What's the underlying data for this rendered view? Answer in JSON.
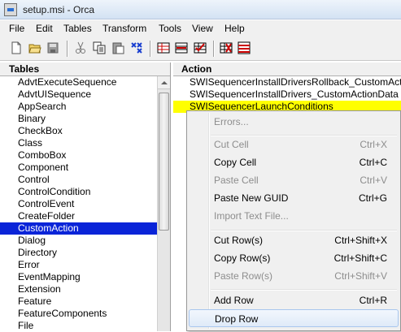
{
  "window": {
    "title": "setup.msi - Orca"
  },
  "menu": [
    "File",
    "Edit",
    "Tables",
    "Transform",
    "Tools",
    "View",
    "Help"
  ],
  "toolbar": {
    "icons": [
      "new-file-icon",
      "open-folder-icon",
      "save-icon",
      "cut-icon",
      "copy-icon",
      "paste-icon",
      "find-icon",
      "tables-icon",
      "add-row-icon",
      "validate-icon",
      "transform-icon",
      "merge-icon"
    ]
  },
  "left_pane": {
    "header": "Tables",
    "items": [
      "AdvtExecuteSequence",
      "AdvtUISequence",
      "AppSearch",
      "Binary",
      "CheckBox",
      "Class",
      "ComboBox",
      "Component",
      "Control",
      "ControlCondition",
      "ControlEvent",
      "CreateFolder",
      "CustomAction",
      "Dialog",
      "Directory",
      "Error",
      "EventMapping",
      "Extension",
      "Feature",
      "FeatureComponents",
      "File"
    ],
    "selected": "CustomAction"
  },
  "right_pane": {
    "header": "Action",
    "rows": [
      "SWISequencerInstallDriversRollback_CustomAction",
      "SWISequencerInstallDrivers_CustomActionData",
      "SWISequencerLaunchConditions"
    ],
    "highlighted_index": 2,
    "highlight_color": "#ffff00"
  },
  "context_menu": {
    "groups": [
      [
        {
          "label": "Errors...",
          "shortcut": "",
          "disabled": true
        }
      ],
      [
        {
          "label": "Cut Cell",
          "shortcut": "Ctrl+X",
          "disabled": true
        },
        {
          "label": "Copy Cell",
          "shortcut": "Ctrl+C",
          "disabled": false
        },
        {
          "label": "Paste Cell",
          "shortcut": "Ctrl+V",
          "disabled": true
        },
        {
          "label": "Paste New GUID",
          "shortcut": "Ctrl+G",
          "disabled": false
        },
        {
          "label": "Import Text File...",
          "shortcut": "",
          "disabled": true
        }
      ],
      [
        {
          "label": "Cut Row(s)",
          "shortcut": "Ctrl+Shift+X",
          "disabled": false
        },
        {
          "label": "Copy Row(s)",
          "shortcut": "Ctrl+Shift+C",
          "disabled": false
        },
        {
          "label": "Paste Row(s)",
          "shortcut": "Ctrl+Shift+V",
          "disabled": true
        }
      ],
      [
        {
          "label": "Add Row",
          "shortcut": "Ctrl+R",
          "disabled": false
        },
        {
          "label": "Drop Row",
          "shortcut": "",
          "disabled": false,
          "hover": true
        }
      ]
    ]
  },
  "colors": {
    "selection": "#0a24d8",
    "menu_bg": "#f0f0f0",
    "disabled_text": "#8d8d8d"
  }
}
